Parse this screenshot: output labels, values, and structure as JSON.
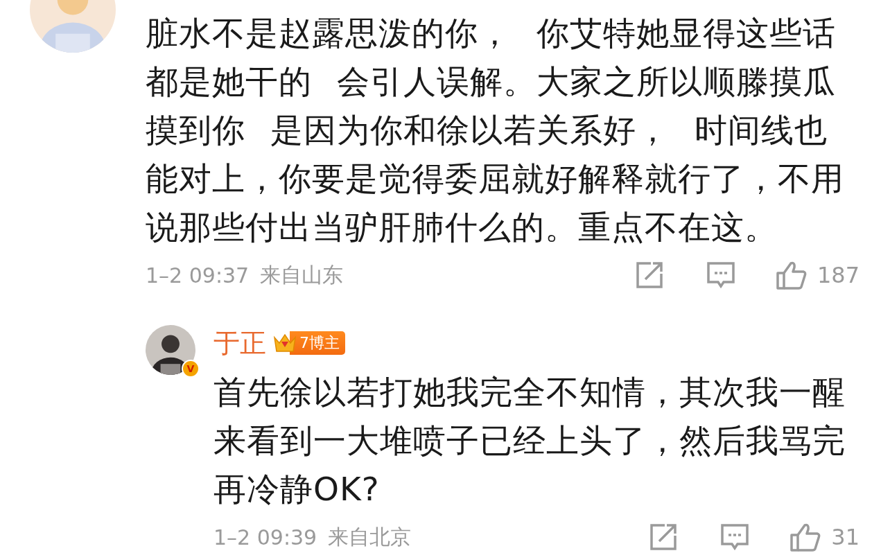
{
  "comments": [
    {
      "kind": "comment",
      "text": "脏水不是赵露思泼的你， 你艾特她显得这些话都是她干的 会引人误解。大家之所以顺滕摸瓜摸到你 是因为你和徐以若关系好， 时间线也能对上，你要是觉得委屈就好解释就行了，不用说那些付出当驴肝肺什么的。重点不在这。",
      "time": "1–2 09:37",
      "location": "来自山东",
      "likes": "187"
    },
    {
      "kind": "reply",
      "name": "于正",
      "badge_level": "7",
      "badge": "博主",
      "verified_mark": "V",
      "text": "首先徐以若打她我完全不知情，其次我一醒来看到一大堆喷子已经上头了，然后我骂完再冷静OK?",
      "time": "1–2 09:39",
      "location": "来自北京",
      "likes": "31"
    }
  ]
}
